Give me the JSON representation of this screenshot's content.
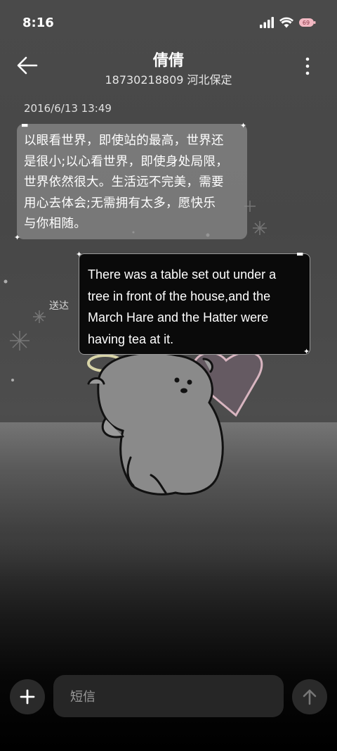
{
  "status_bar": {
    "time": "8:16",
    "icons": [
      "signal-icon",
      "wifi-icon",
      "battery-icon"
    ]
  },
  "header": {
    "contact_name": "倩倩",
    "contact_info": "18730218809 河北保定",
    "back_icon": "back-arrow-icon",
    "more_icon": "more-vertical-icon"
  },
  "conversation": {
    "timestamp": "2016/6/13 13:49",
    "incoming_message": {
      "lines": [
        "以眼看世界，即使站的最高，世界还",
        "是很小;以心看世界，即使身处局限，",
        "世界依然很大。生活远不完美，需要",
        "用心去体会;无需拥有太多，愿快乐",
        "与你相随。"
      ]
    },
    "outgoing_message": {
      "lines": [
        "There was a table set out under a",
        "tree in front of the house,and the",
        "March Hare and the Hatter were",
        "having tea at it."
      ],
      "status": "送达"
    }
  },
  "compose": {
    "placeholder": "短信",
    "add_icon": "plus-icon",
    "send_icon": "send-arrow-icon"
  },
  "colors": {
    "incoming_bubble": "#8c8c8c",
    "outgoing_bubble": "#0a0a0a",
    "outgoing_border": "#9a9a9a",
    "compose_background": "#262626"
  }
}
